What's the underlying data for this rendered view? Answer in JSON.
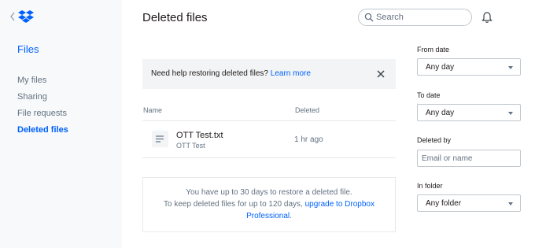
{
  "sidebar": {
    "title": "Files",
    "items": [
      {
        "label": "My files"
      },
      {
        "label": "Sharing"
      },
      {
        "label": "File requests"
      },
      {
        "label": "Deleted files",
        "active": true
      }
    ]
  },
  "header": {
    "title": "Deleted files",
    "search_placeholder": "Search"
  },
  "banner": {
    "text": "Need help restoring deleted files?",
    "link": "Learn more"
  },
  "table": {
    "columns": [
      "Name",
      "Deleted"
    ],
    "rows": [
      {
        "name": "OTT Test.txt",
        "folder": "OTT Test",
        "deleted": "1 hr ago",
        "icon": "text-file-icon"
      }
    ]
  },
  "info": {
    "line1": "You have up to 30 days to restore a deleted file.",
    "line2": "To keep deleted files for up to 120 days,",
    "link": "upgrade to Dropbox Professional",
    "end": "."
  },
  "filters": {
    "from_date": {
      "label": "From date",
      "value": "Any day"
    },
    "to_date": {
      "label": "To date",
      "value": "Any day"
    },
    "deleted_by": {
      "label": "Deleted by",
      "placeholder": "Email or name"
    },
    "in_folder": {
      "label": "In folder",
      "value": "Any folder"
    }
  },
  "colors": {
    "accent": "#0061fe",
    "sidebar_bg": "#f7f9fa",
    "muted_text": "#637282"
  }
}
